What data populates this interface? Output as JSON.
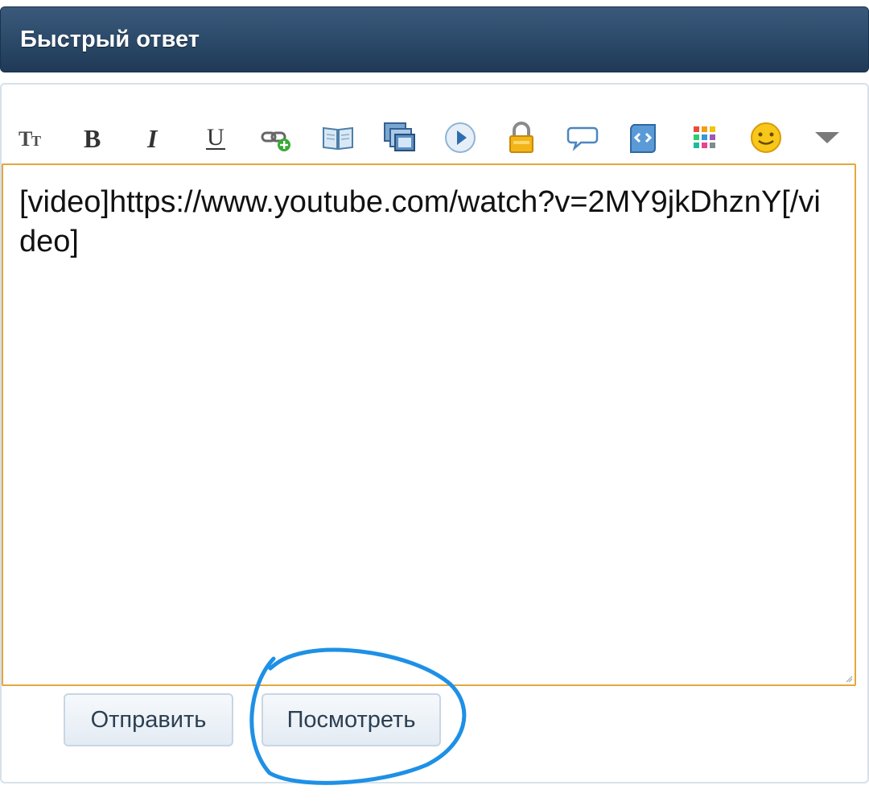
{
  "header": {
    "title": "Быстрый ответ"
  },
  "toolbar": {
    "icons": [
      "font-size-icon",
      "bold-icon",
      "italic-icon",
      "underline-icon",
      "link-icon",
      "book-icon",
      "image-icon",
      "video-icon",
      "lock-icon",
      "quote-icon",
      "code-icon",
      "color-palette-icon",
      "smiley-icon",
      "more-dropdown-icon"
    ]
  },
  "editor": {
    "value": "[video]https://www.youtube.com/watch?v=2MY9jkDhznY[/video]"
  },
  "buttons": {
    "submit_label": "Отправить",
    "preview_label": "Посмотреть"
  },
  "colors": {
    "header": "#2c4a6a",
    "editor_border": "#e4a73c",
    "annotation": "#1e90e6"
  }
}
